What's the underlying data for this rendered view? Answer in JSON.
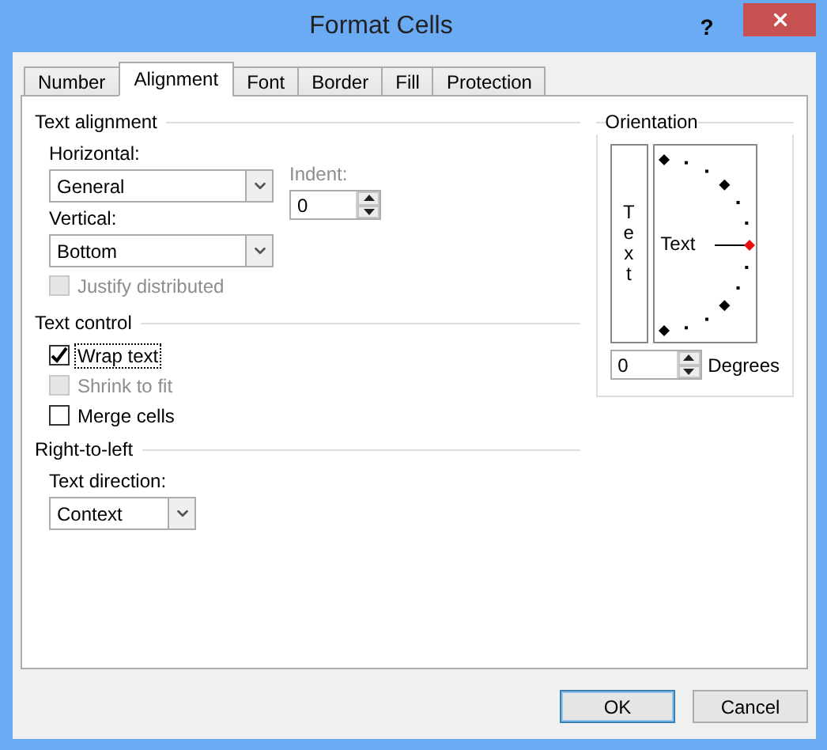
{
  "window": {
    "title": "Format Cells",
    "help": "?"
  },
  "tabs": [
    {
      "label": "Number",
      "selected": false
    },
    {
      "label": "Alignment",
      "selected": true
    },
    {
      "label": "Font",
      "selected": false
    },
    {
      "label": "Border",
      "selected": false
    },
    {
      "label": "Fill",
      "selected": false
    },
    {
      "label": "Protection",
      "selected": false
    }
  ],
  "text_alignment": {
    "heading": "Text alignment",
    "horizontal": {
      "label": "Horizontal:",
      "value": "General"
    },
    "vertical": {
      "label": "Vertical:",
      "value": "Bottom"
    },
    "indent": {
      "label": "Indent:",
      "value": "0",
      "disabled": true
    },
    "justify_distributed": {
      "label": "Justify distributed",
      "checked": false,
      "disabled": true
    }
  },
  "text_control": {
    "heading": "Text control",
    "options": [
      {
        "label": "Wrap text",
        "checked": true,
        "disabled": false,
        "focused": true
      },
      {
        "label": "Shrink to fit",
        "checked": false,
        "disabled": true,
        "focused": false
      },
      {
        "label": "Merge cells",
        "checked": false,
        "disabled": false,
        "focused": false
      }
    ]
  },
  "right_to_left": {
    "heading": "Right-to-left",
    "text_direction": {
      "label": "Text direction:",
      "value": "Context"
    }
  },
  "orientation": {
    "heading": "Orientation",
    "vertical_text": "Text",
    "dial_text": "Text",
    "degrees": {
      "value": "0",
      "label": "Degrees"
    }
  },
  "buttons": [
    {
      "label": "OK",
      "default": true
    },
    {
      "label": "Cancel",
      "default": false
    }
  ]
}
